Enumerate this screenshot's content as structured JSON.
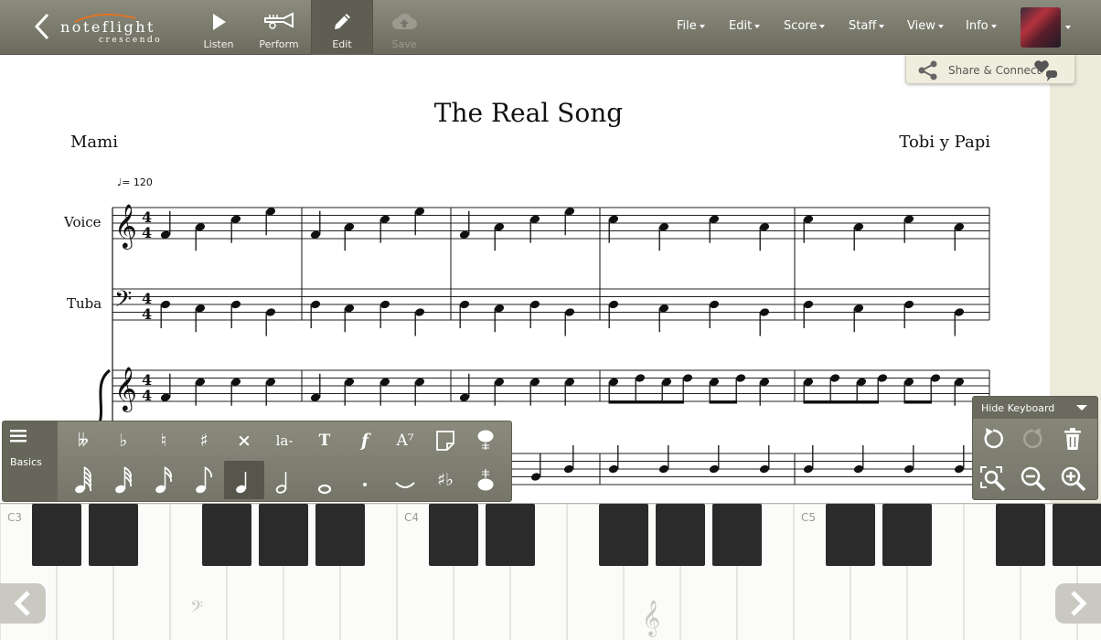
{
  "app": {
    "logo_text": "noteflight",
    "logo_sub": "crescendo"
  },
  "toolbar": {
    "listen_label": "Listen",
    "perform_label": "Perform",
    "edit_label": "Edit",
    "save_label": "Save"
  },
  "menu": {
    "file": "File",
    "edit": "Edit",
    "score": "Score",
    "staff": "Staff",
    "view": "View",
    "info": "Info"
  },
  "share": {
    "label": "Share & Connect"
  },
  "score": {
    "title": "The Real Song",
    "lyricist": "Mami",
    "composer": "Tobi y Papi",
    "tempo_bpm": "= 120",
    "time_signature": "4/4",
    "staves": [
      {
        "name": "Voice",
        "clef": "treble"
      },
      {
        "name": "Tuba",
        "clef": "bass"
      },
      {
        "name": "",
        "clef": "treble"
      }
    ]
  },
  "palette": {
    "tab_label": "Basics",
    "row1": [
      {
        "icon": "double-flat-icon",
        "text": "𝄫"
      },
      {
        "icon": "flat-icon",
        "text": "♭"
      },
      {
        "icon": "natural-icon",
        "text": "♮"
      },
      {
        "icon": "sharp-icon",
        "text": "♯"
      },
      {
        "icon": "double-sharp-icon",
        "text": "×"
      },
      {
        "icon": "lyrics-icon",
        "text": "la-"
      },
      {
        "icon": "text-icon",
        "text": "T"
      },
      {
        "icon": "dynamics-icon",
        "text": "f"
      },
      {
        "icon": "chord-symbol-icon",
        "text": "A⁷"
      },
      {
        "icon": "sticky-note-icon",
        "text": ""
      },
      {
        "icon": "grace-note-up-icon",
        "text": ""
      }
    ],
    "row2": [
      {
        "icon": "sixty-fourth-note-icon"
      },
      {
        "icon": "thirty-second-note-icon"
      },
      {
        "icon": "sixteenth-note-icon"
      },
      {
        "icon": "eighth-note-icon"
      },
      {
        "icon": "quarter-note-icon"
      },
      {
        "icon": "half-note-icon"
      },
      {
        "icon": "whole-note-icon"
      },
      {
        "icon": "dot-icon"
      },
      {
        "icon": "tie-icon"
      },
      {
        "icon": "enharmonic-icon"
      },
      {
        "icon": "grace-note-down-icon"
      }
    ],
    "selected": "quarter-note-icon"
  },
  "keyboard_panel": {
    "hide_label": "Hide Keyboard"
  },
  "piano": {
    "octave_labels": [
      "C3",
      "C4",
      "C5"
    ]
  },
  "colors": {
    "toolbar": "#76766a",
    "accent_logo": "#e8731c"
  }
}
